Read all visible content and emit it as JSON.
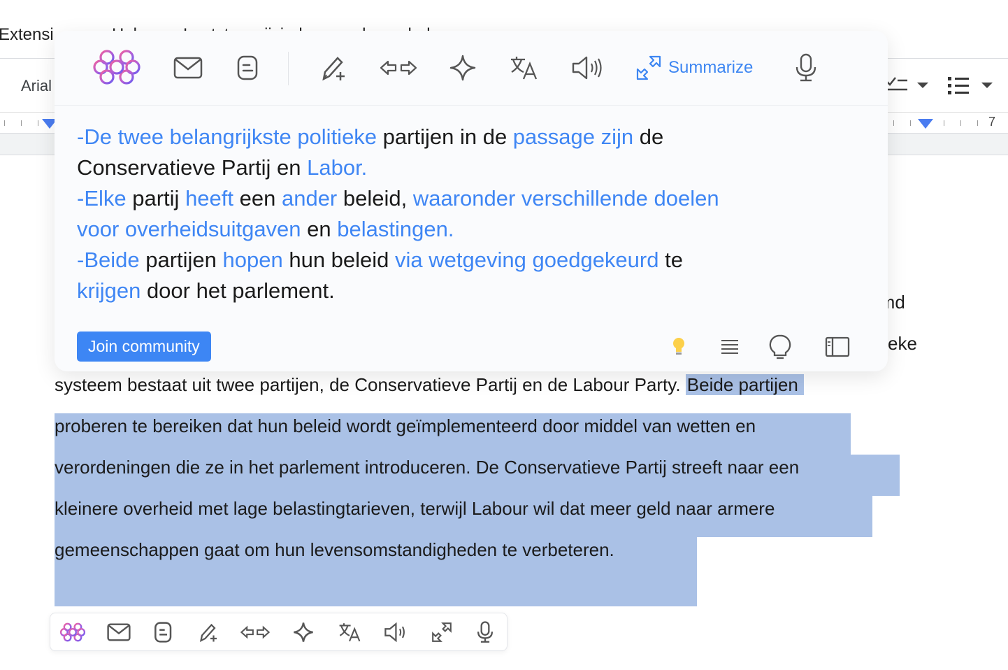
{
  "app": {
    "menu": {
      "extensions": "Extensi",
      "help": "Help",
      "last_edit": "Laatst gewijzigd: seconden geleden"
    },
    "toolbar": {
      "font": "Arial"
    },
    "ruler": {
      "number": "7"
    }
  },
  "document": {
    "fragments": {
      "right1": "rmd",
      "right2": "eke"
    },
    "line1_plain": "systeem bestaat uit twee partijen, de Conservatieve Partij en de Labour Party. ",
    "line1_selected": "Beide partijen",
    "selected_lines": [
      "proberen te bereiken dat hun beleid wordt geïmplementeerd door middel van wetten en",
      "verordeningen die ze in het parlement introduceren. De Conservatieve Partij streeft naar een",
      "kleinere overheid met lage belastingtarieven, terwijl Labour wil dat meer geld naar armere",
      "gemeenschappen gaat om hun levensomstandigheden te verbeteren."
    ]
  },
  "popup": {
    "toolbar": {
      "icons": [
        "brain-logo-icon",
        "mail-icon",
        "blog-icon",
        "pen-plus-icon",
        "rephrase-arrows-icon",
        "sparkle-icon",
        "translate-icon",
        "speaker-icon",
        "summarize-icon",
        "microphone-icon"
      ],
      "summarize_label": "Summarize"
    },
    "summary_lines": [
      [
        {
          "t": "-De twee belangrijkste politieke",
          "b": true
        },
        {
          "t": " partijen in de ",
          "b": false
        },
        {
          "t": "passage zijn",
          "b": true
        },
        {
          "t": " de",
          "b": false
        }
      ],
      [
        {
          "t": "Conservatieve Partij en ",
          "b": false
        },
        {
          "t": "Labor.",
          "b": true
        }
      ],
      [
        {
          "t": "-Elke",
          "b": true
        },
        {
          "t": " partij ",
          "b": false
        },
        {
          "t": "heeft",
          "b": true
        },
        {
          "t": " een ",
          "b": false
        },
        {
          "t": "ander",
          "b": true
        },
        {
          "t": " beleid, ",
          "b": false
        },
        {
          "t": "waaronder verschillende doelen",
          "b": true
        }
      ],
      [
        {
          "t": "voor overheidsuitgaven",
          "b": true
        },
        {
          "t": " en ",
          "b": false
        },
        {
          "t": "belastingen.",
          "b": true
        }
      ],
      [
        {
          "t": "-Beide",
          "b": true
        },
        {
          "t": " partijen ",
          "b": false
        },
        {
          "t": "hopen",
          "b": true
        },
        {
          "t": " hun beleid ",
          "b": false
        },
        {
          "t": "via wetgeving goedgekeurd",
          "b": true
        },
        {
          "t": " te",
          "b": false
        }
      ],
      [
        {
          "t": "krijgen",
          "b": true
        },
        {
          "t": " door het parlement.",
          "b": false
        }
      ]
    ],
    "join_label": "Join community",
    "footer_icons": [
      "lightbulb-color-icon",
      "text-align-icon",
      "idea-outline-icon",
      "sidebar-panel-icon"
    ]
  },
  "mini_toolbar": {
    "icons": [
      "brain-logo-icon",
      "mail-icon",
      "blog-icon",
      "pen-plus-icon",
      "rephrase-arrows-icon",
      "sparkle-icon",
      "translate-icon",
      "speaker-icon",
      "summarize-icon",
      "microphone-icon"
    ]
  },
  "colors": {
    "accent": "#3d86f4",
    "selection": "#aac1e6",
    "link_text": "#3f86f4"
  }
}
